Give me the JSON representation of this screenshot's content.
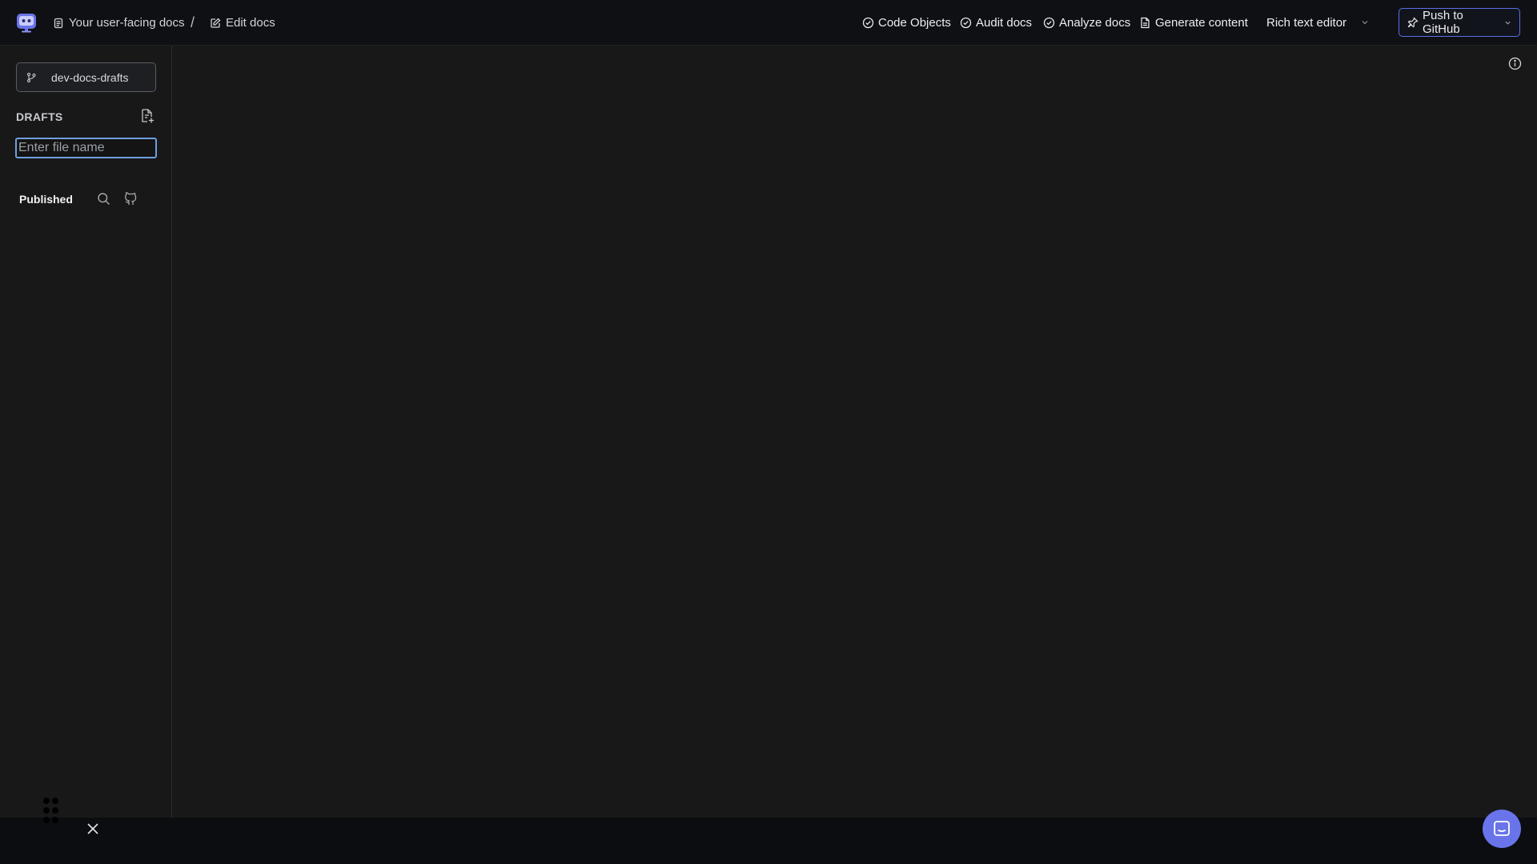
{
  "breadcrumb": {
    "docs_label": "Your user-facing docs",
    "separator": "/",
    "edit_label": "Edit docs"
  },
  "nav": {
    "code_objects": "Code Objects",
    "audit_docs": "Audit docs",
    "analyze_docs": "Analyze docs",
    "generate_content": "Generate content"
  },
  "editor_select": {
    "selected": "Rich text editor"
  },
  "push": {
    "label": "Push to GitHub"
  },
  "sidebar": {
    "branch": "dev-docs-drafts",
    "drafts_heading": "DRAFTS",
    "file_input_placeholder": "Enter file name",
    "published_heading": "Published"
  },
  "colors": {
    "accent": "#5b6fe8",
    "chat_button": "#6a74ea",
    "input_focus": "#6f9fe0",
    "background": "#181818",
    "topbar": "#0e1014"
  },
  "icons": {
    "logo": "app-logo-icon",
    "docs": "document-icon",
    "edit": "edit-icon",
    "check": "check-circle-icon",
    "file": "file-icon",
    "chevron": "chevron-down-icon",
    "push": "push-icon",
    "branch": "git-branch-icon",
    "new_file": "file-plus-icon",
    "search": "search-icon",
    "github": "github-icon",
    "info": "info-icon",
    "grip": "drag-grip-icon",
    "close": "close-icon",
    "chat": "chat-icon"
  }
}
